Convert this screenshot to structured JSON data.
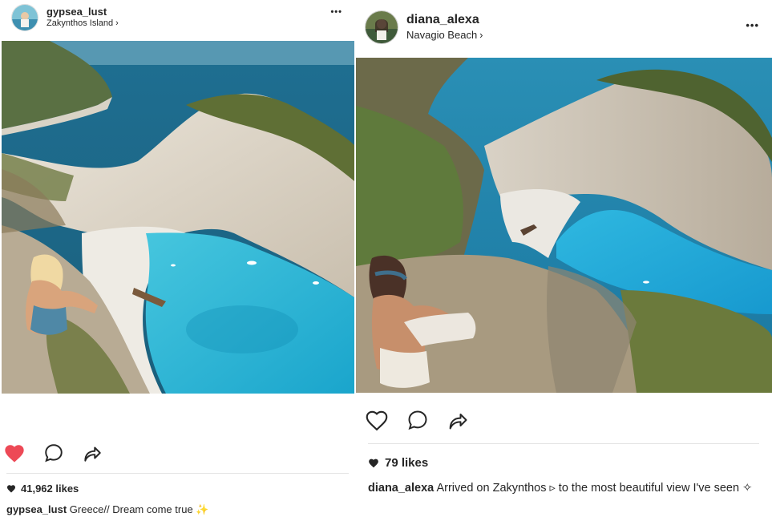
{
  "posts": [
    {
      "username": "gypsea_lust",
      "location": "Zakynthos Island",
      "more_label": "•••",
      "liked": true,
      "likes": "41,962 likes",
      "caption_user": "gypsea_lust",
      "caption_text": "Greece// Dream come true ✨",
      "colors": {
        "like_red": "#ed4956"
      }
    },
    {
      "username": "diana_alexa",
      "location": "Navagio Beach",
      "more_label": "•••",
      "liked": false,
      "likes": "79 likes",
      "caption_user": "diana_alexa",
      "caption_text": "Arrived on Zakynthos ▹ to the most beautiful view I've seen ✧"
    }
  ],
  "icons": {
    "chevron": "chevron-right-icon",
    "heart": "heart-icon",
    "comment": "comment-icon",
    "share": "share-icon",
    "more": "more-options-icon"
  }
}
